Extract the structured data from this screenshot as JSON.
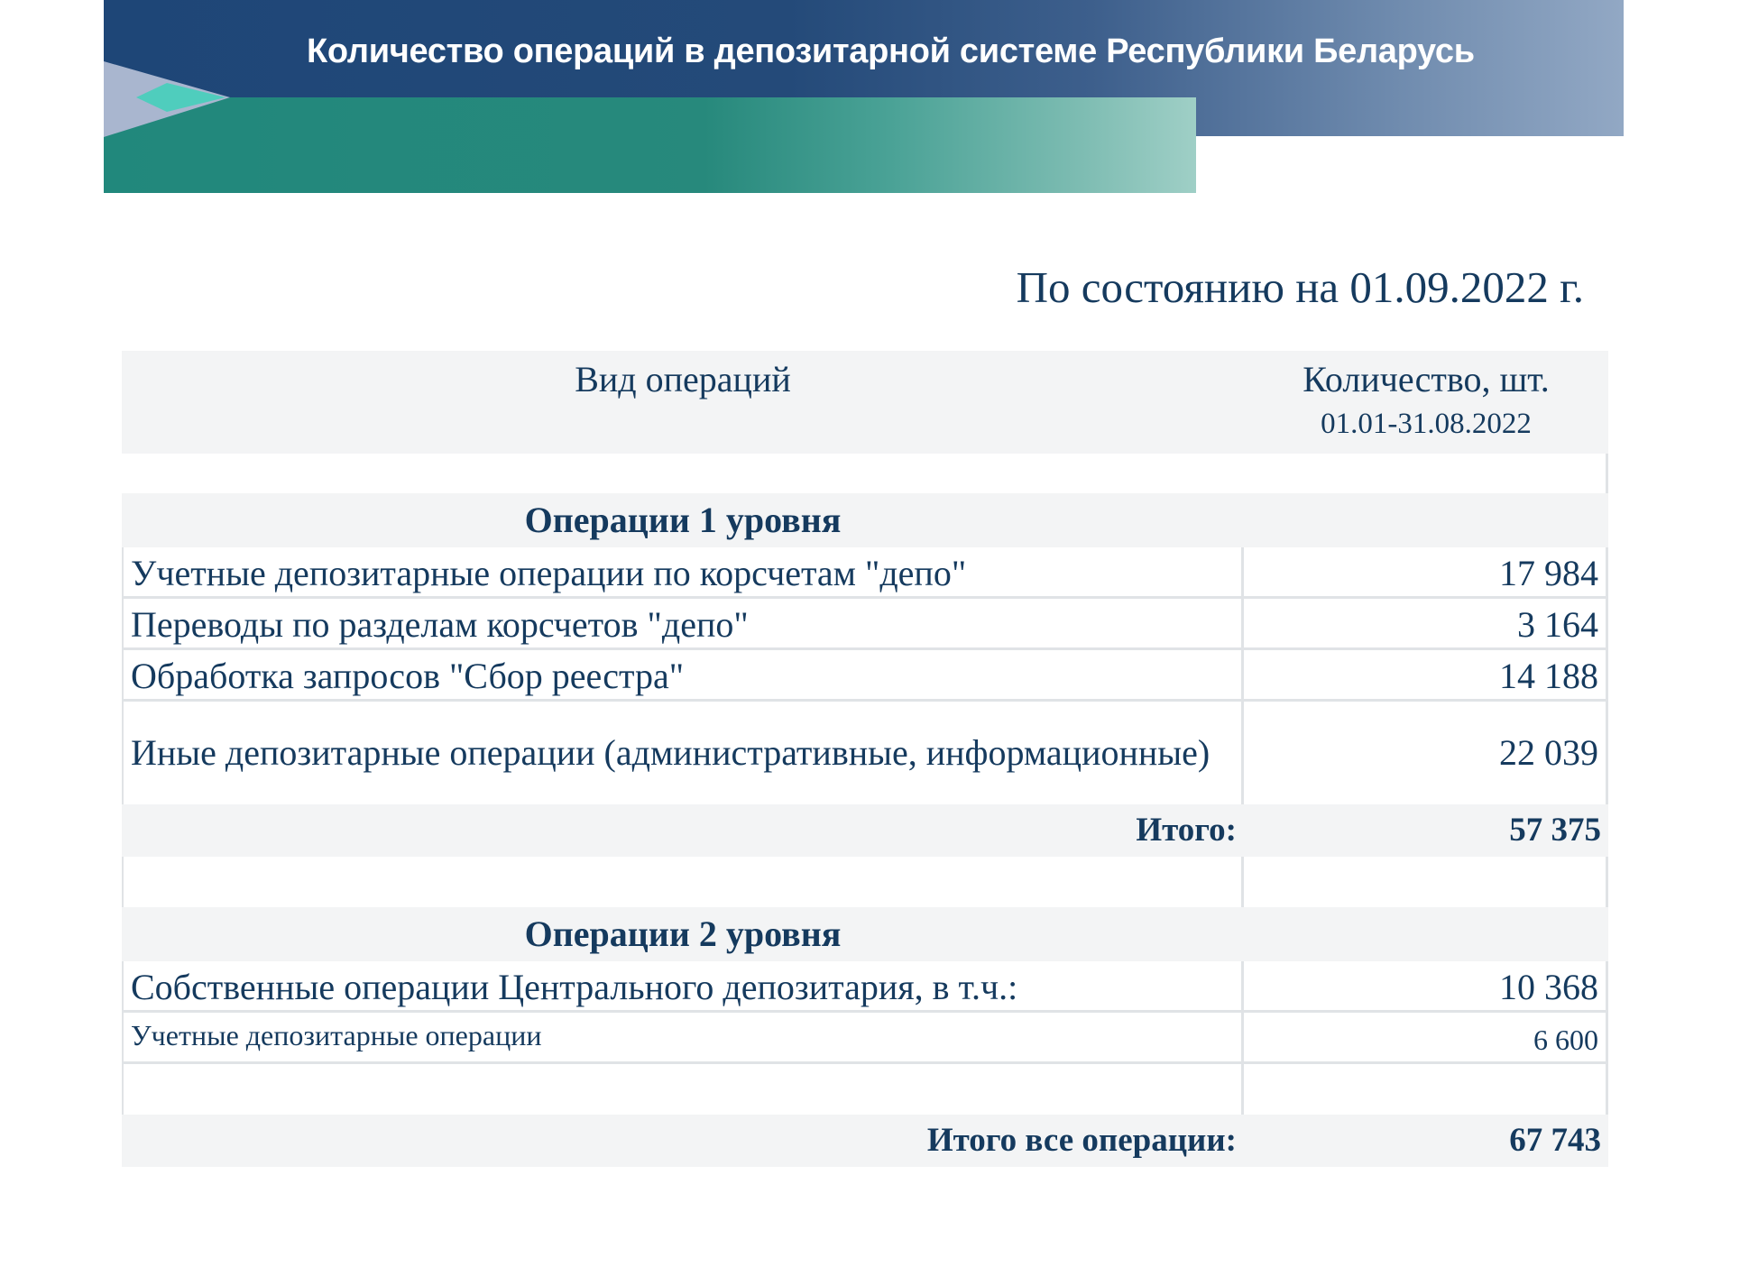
{
  "banner": {
    "title": "Количество операций в  депозитарной системе Республики Беларусь"
  },
  "as_of": "По состоянию на 01.09.2022 г.",
  "table": {
    "header": {
      "col1": "Вид операций",
      "col2": "Количество, шт.",
      "period": "01.01-31.08.2022"
    },
    "level1": {
      "title": "Операции 1 уровня",
      "rows": [
        {
          "label": "Учетные депозитарные операции по корсчетам \"депо\"",
          "value": "17 984"
        },
        {
          "label": "Переводы по разделам корсчетов \"депо\"",
          "value": "3 164"
        },
        {
          "label": "Обработка запросов \"Сбор реестра\"",
          "value": "14 188"
        },
        {
          "label": "Иные депозитарные операции (административные, информационные)",
          "value": "22 039"
        }
      ],
      "total_label": "Итого:",
      "total_value": "57 375"
    },
    "level2": {
      "title": "Операции 2 уровня",
      "rows": [
        {
          "label": "Собственные операции Центрального депозитария, в т.ч.:",
          "value": "10 368"
        },
        {
          "label": "Учетные депозитарные операции",
          "value": "6 600"
        }
      ]
    },
    "grand_total_label": "Итого все операции:",
    "grand_total_value": "67 743"
  }
}
